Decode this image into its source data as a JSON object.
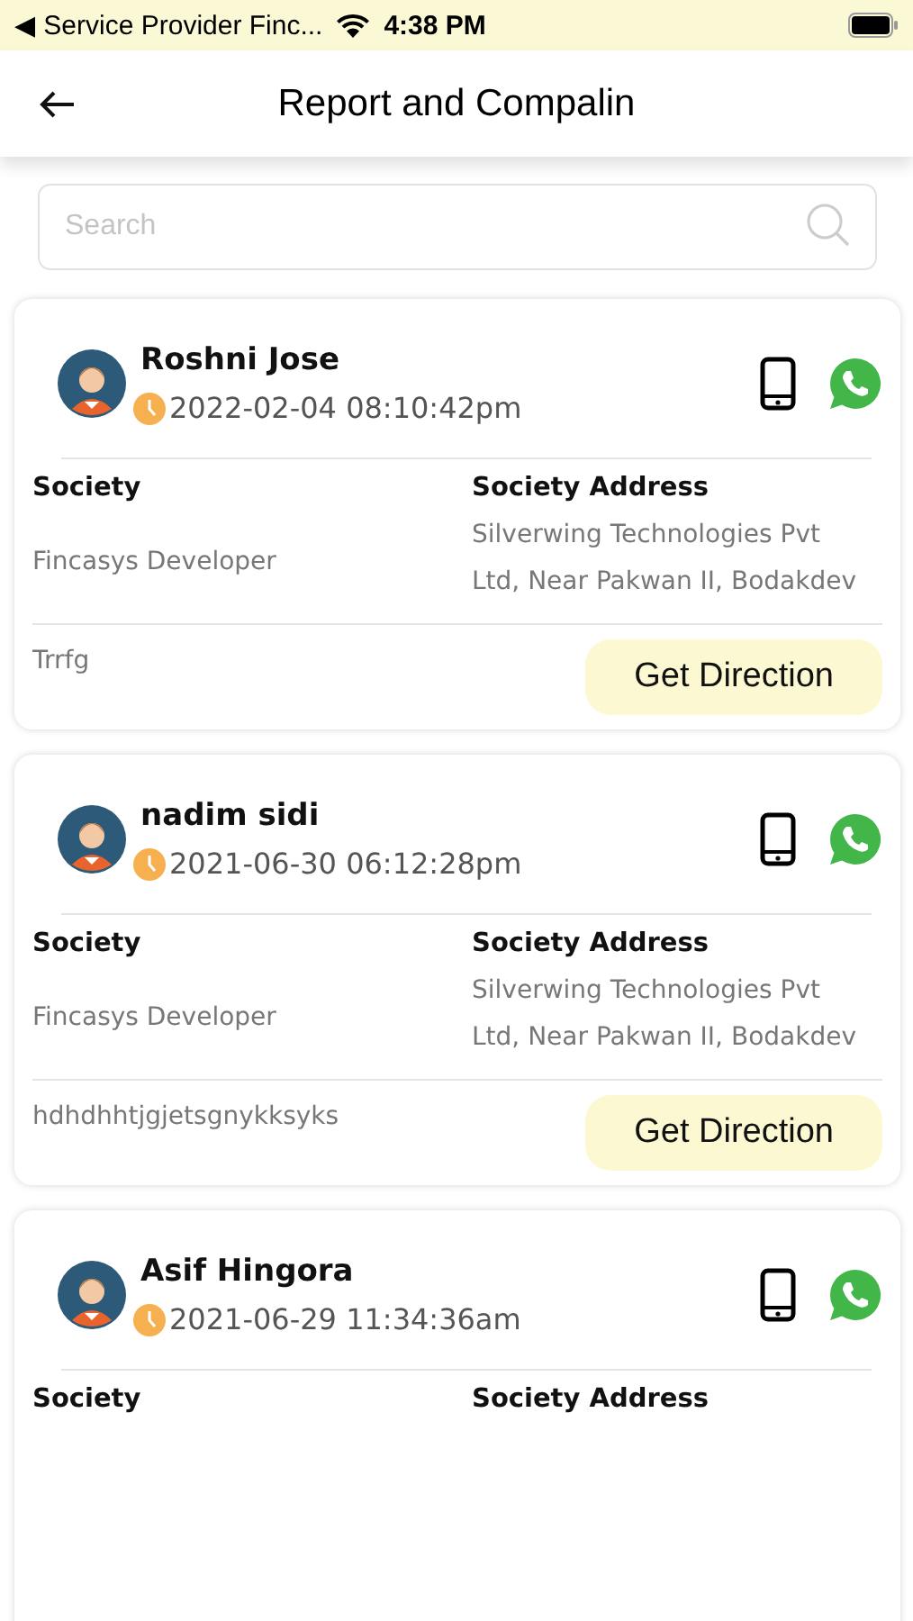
{
  "status_bar": {
    "back_app": "◀ Service  Provider  Finc...",
    "time": "4:38 PM"
  },
  "header": {
    "title": "Report and Compalin"
  },
  "search": {
    "placeholder": "Search"
  },
  "cards": [
    {
      "name": "Roshni Jose",
      "time": "2022-02-04 08:10:42pm",
      "society_label": "Society",
      "society": "Fincasys Developer",
      "address_label": "Society Address",
      "address": "Silverwing Technologies Pvt Ltd, Near Pakwan II, Bodakdev",
      "note": "Trrfg",
      "button": "Get Direction"
    },
    {
      "name": "nadim sidi",
      "time": "2021-06-30 06:12:28pm",
      "society_label": "Society",
      "society": "Fincasys Developer",
      "address_label": "Society Address",
      "address": "Silverwing Technologies Pvt Ltd, Near Pakwan II, Bodakdev",
      "note": "hdhdhhtjgjetsgnykksyks",
      "button": "Get Direction"
    },
    {
      "name": "Asif Hingora",
      "time": "2021-06-29 11:34:36am",
      "society_label": "Society",
      "address_label": "Society Address"
    }
  ]
}
